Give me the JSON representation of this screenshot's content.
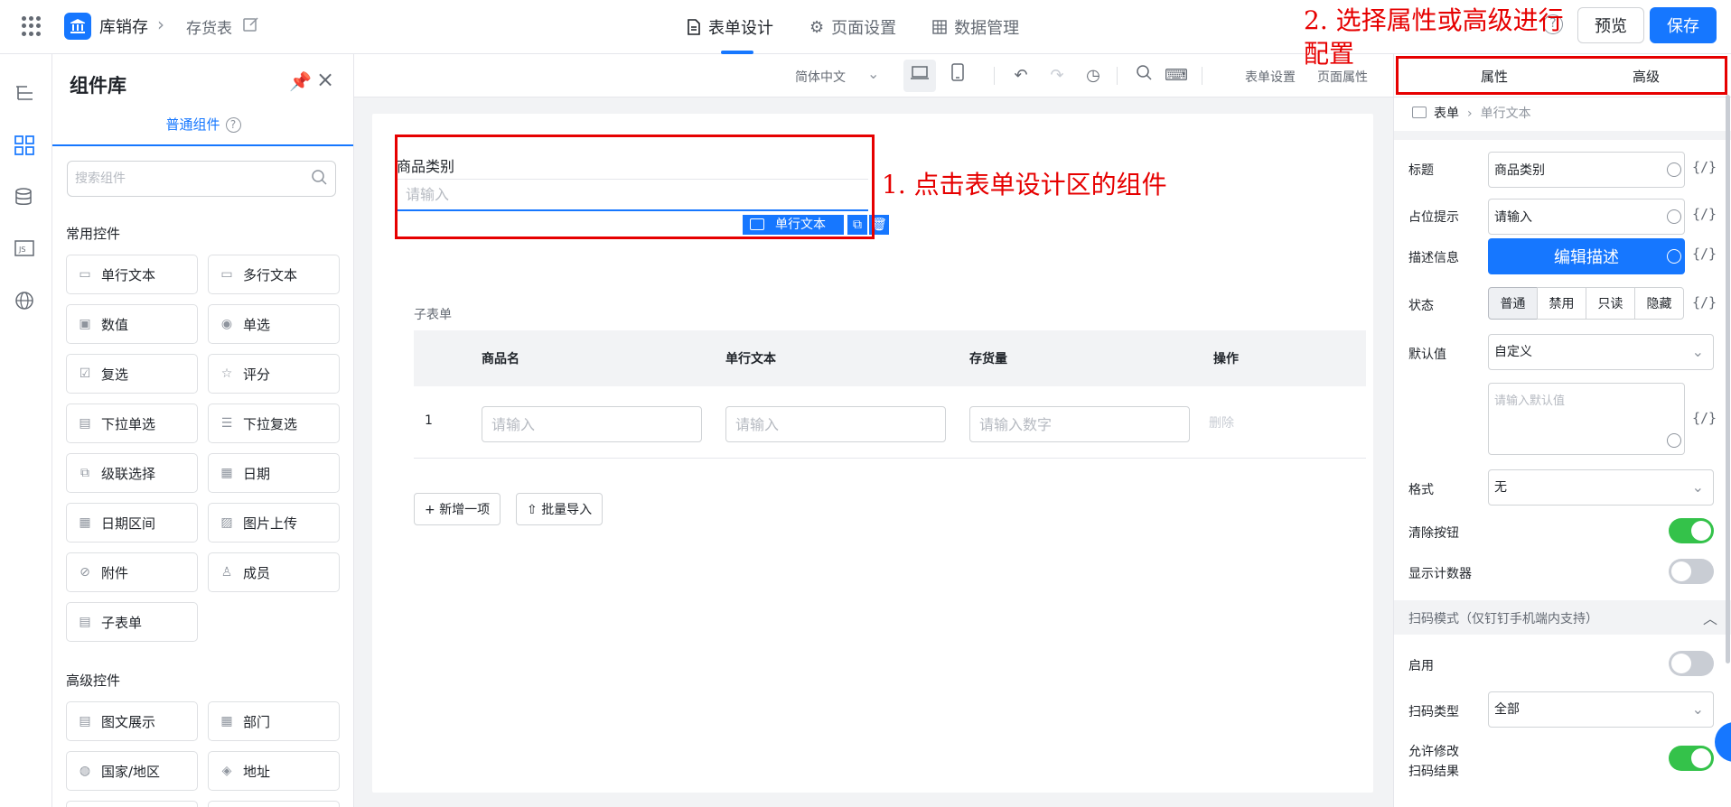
{
  "topbar": {
    "app_name": "库销存",
    "page_name": "存货表",
    "tabs": [
      {
        "label": "表单设计",
        "icon": "document-icon",
        "active": true
      },
      {
        "label": "页面设置",
        "icon": "gear-icon",
        "active": false
      },
      {
        "label": "数据管理",
        "icon": "grid-icon",
        "active": false
      }
    ],
    "help_glyph": "?",
    "preview_label": "预览",
    "save_label": "保存"
  },
  "library": {
    "title": "组件库",
    "tab_label": "普通组件",
    "search_placeholder": "搜索组件",
    "common_title": "常用控件",
    "common": [
      {
        "label": "单行文本",
        "icon": "single-text-icon"
      },
      {
        "label": "多行文本",
        "icon": "multi-text-icon"
      },
      {
        "label": "数值",
        "icon": "number-icon"
      },
      {
        "label": "单选",
        "icon": "radio-icon"
      },
      {
        "label": "复选",
        "icon": "checkbox-icon"
      },
      {
        "label": "评分",
        "icon": "star-icon"
      },
      {
        "label": "下拉单选",
        "icon": "dropdown-icon"
      },
      {
        "label": "下拉复选",
        "icon": "multi-dropdown-icon"
      },
      {
        "label": "级联选择",
        "icon": "cascade-icon"
      },
      {
        "label": "日期",
        "icon": "calendar-icon"
      },
      {
        "label": "日期区间",
        "icon": "date-range-icon"
      },
      {
        "label": "图片上传",
        "icon": "image-icon"
      },
      {
        "label": "附件",
        "icon": "paperclip-icon"
      },
      {
        "label": "成员",
        "icon": "user-icon"
      },
      {
        "label": "子表单",
        "icon": "subform-icon"
      }
    ],
    "advanced_title": "高级控件",
    "advanced": [
      {
        "label": "图文展示",
        "icon": "richtext-icon"
      },
      {
        "label": "部门",
        "icon": "department-icon"
      },
      {
        "label": "国家/地区",
        "icon": "globe-icon"
      },
      {
        "label": "地址",
        "icon": "map-icon"
      }
    ]
  },
  "canvas_toolbar": {
    "language": "简体中文",
    "form_settings": "表单设置",
    "page_props": "页面属性"
  },
  "form": {
    "field_label": "商品类别",
    "field_placeholder": "请输入",
    "component_tag": "单行文本",
    "subform_title": "子表单",
    "subform_headers": [
      "商品名",
      "单行文本",
      "存货量",
      "操作"
    ],
    "subform_row": {
      "index": "1",
      "placeholders": [
        "请输入",
        "请输入",
        "请输入数字"
      ],
      "delete_label": "删除"
    },
    "add_item": "+ 新增一项",
    "batch_import": "批量导入"
  },
  "annotations": {
    "step1": "1. 点击表单设计区的组件",
    "step2": "2. 选择属性或高级进行配置",
    "color": "#e60000"
  },
  "props": {
    "tabs": [
      "属性",
      "高级"
    ],
    "crumb_root": "表单",
    "crumb_current": "单行文本",
    "title_label": "标题",
    "title_value": "商品类别",
    "placeholder_label": "占位提示",
    "placeholder_value": "请输入",
    "desc_label": "描述信息",
    "desc_button": "编辑描述",
    "state_label": "状态",
    "states": [
      "普通",
      "禁用",
      "只读",
      "隐藏"
    ],
    "default_label": "默认值",
    "default_mode": "自定义",
    "default_placeholder": "请输入默认值",
    "format_label": "格式",
    "format_value": "无",
    "clear_label": "清除按钮",
    "counter_label": "显示计数器",
    "scan_section": "扫码模式（仅钉钉手机端内支持）",
    "scan_enable_label": "启用",
    "scan_type_label": "扫码类型",
    "scan_type_value": "全部",
    "scan_modify_label_1": "允许修改",
    "scan_modify_label_2": "扫码结果",
    "expr_glyph": "{/}",
    "clear_on": true,
    "counter_on": false,
    "scan_on": false,
    "scan_modify_on": true
  },
  "colors": {
    "accent": "#1677ff",
    "toggle_on": "#34c24a",
    "annotation": "#e60000"
  }
}
